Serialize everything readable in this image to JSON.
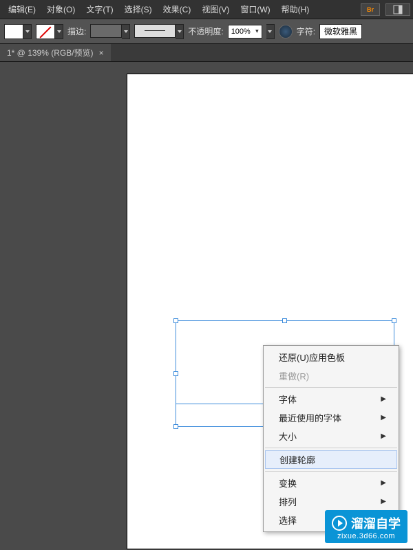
{
  "menubar": {
    "items": [
      {
        "label": "编辑(E)"
      },
      {
        "label": "对象(O)"
      },
      {
        "label": "文字(T)"
      },
      {
        "label": "选择(S)"
      },
      {
        "label": "效果(C)"
      },
      {
        "label": "视图(V)"
      },
      {
        "label": "窗口(W)"
      },
      {
        "label": "帮助(H)"
      }
    ],
    "bridge_label": "Br"
  },
  "toolbar": {
    "stroke_label": "描边:",
    "opacity_label": "不透明度:",
    "opacity_value": "100%",
    "char_label": "字符:",
    "font_value": "微软雅黑"
  },
  "document": {
    "tab_label": "1* @ 139% (RGB/预览)"
  },
  "context_menu": {
    "undo": "还原(U)应用色板",
    "redo": "重做(R)",
    "font": "字体",
    "recent_fonts": "最近使用的字体",
    "size": "大小",
    "create_outlines": "创建轮廓",
    "transform": "变换",
    "arrange": "排列",
    "select": "选择"
  },
  "watermark": {
    "text": "溜溜自学",
    "url": "zixue.3d66.com"
  }
}
